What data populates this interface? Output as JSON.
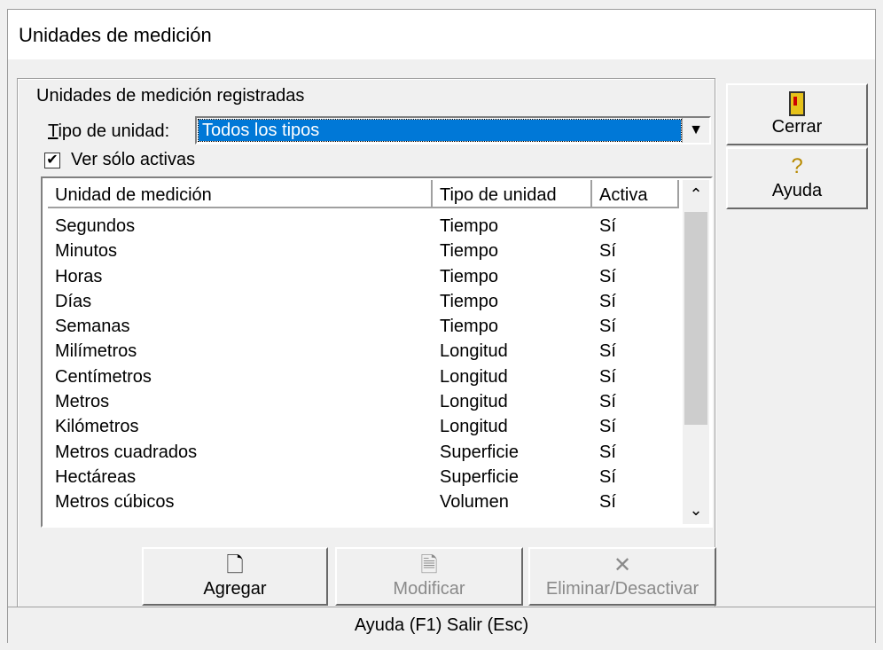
{
  "window": {
    "title": "Unidades de medición"
  },
  "group": {
    "legend": "Unidades de medición registradas"
  },
  "filter": {
    "tipo_label_accel": "T",
    "tipo_label_rest": "ipo de unidad:",
    "tipo_value": "Todos los tipos",
    "checkbox_label": "Ver sólo activas",
    "checkbox_checked": true
  },
  "list": {
    "columns": [
      "Unidad de medición",
      "Tipo de unidad",
      "Activa"
    ],
    "rows": [
      [
        "Segundos",
        "Tiempo",
        "Sí"
      ],
      [
        "Minutos",
        "Tiempo",
        "Sí"
      ],
      [
        "Horas",
        "Tiempo",
        "Sí"
      ],
      [
        "Días",
        "Tiempo",
        "Sí"
      ],
      [
        "Semanas",
        "Tiempo",
        "Sí"
      ],
      [
        "Milímetros",
        "Longitud",
        "Sí"
      ],
      [
        "Centímetros",
        "Longitud",
        "Sí"
      ],
      [
        "Metros",
        "Longitud",
        "Sí"
      ],
      [
        "Kilómetros",
        "Longitud",
        "Sí"
      ],
      [
        "Metros cuadrados",
        "Superficie",
        "Sí"
      ],
      [
        "Hectáreas",
        "Superficie",
        "Sí"
      ],
      [
        "Metros cúbicos",
        "Volumen",
        "Sí"
      ]
    ]
  },
  "buttons": {
    "agregar": "Agregar",
    "modificar": "Modificar",
    "eliminar": "Eliminar/Desactivar",
    "cerrar": "Cerrar",
    "ayuda": "Ayuda"
  },
  "status": {
    "text": "Ayuda (F1)   Salir (Esc)"
  },
  "icons": {
    "agregar": "new-document-icon",
    "modificar": "edit-icon",
    "eliminar": "delete-icon",
    "cerrar": "door-icon",
    "ayuda": "help-question-icon"
  }
}
